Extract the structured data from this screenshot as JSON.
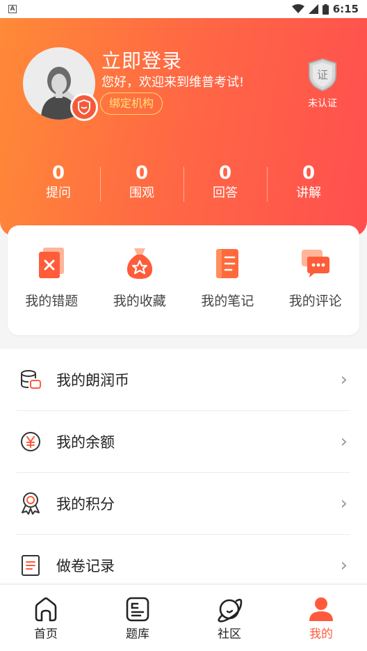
{
  "status_bar": {
    "time": "6:15",
    "left_icon": "A"
  },
  "profile": {
    "title": "立即登录",
    "welcome": "您好，欢迎来到维普考试!",
    "bind_button": "绑定机构",
    "cert_glyph": "证",
    "cert_label": "未认证"
  },
  "stats": [
    {
      "value": "0",
      "label": "提问"
    },
    {
      "value": "0",
      "label": "围观"
    },
    {
      "value": "0",
      "label": "回答"
    },
    {
      "value": "0",
      "label": "讲解"
    }
  ],
  "quick_actions": [
    {
      "label": "我的错题",
      "icon": "wrong-questions-icon"
    },
    {
      "label": "我的收藏",
      "icon": "favorites-bag-icon"
    },
    {
      "label": "我的笔记",
      "icon": "notes-icon"
    },
    {
      "label": "我的评论",
      "icon": "comments-icon"
    }
  ],
  "menu": [
    {
      "label": "我的朗润币",
      "icon": "coins-icon"
    },
    {
      "label": "我的余额",
      "icon": "yuan-icon"
    },
    {
      "label": "我的积分",
      "icon": "medal-icon"
    },
    {
      "label": "做卷记录",
      "icon": "exam-record-icon"
    }
  ],
  "tabs": [
    {
      "label": "首页",
      "icon": "home-icon",
      "active": false
    },
    {
      "label": "题库",
      "icon": "question-bank-icon",
      "active": false
    },
    {
      "label": "社区",
      "icon": "community-planet-icon",
      "active": false
    },
    {
      "label": "我的",
      "icon": "profile-icon",
      "active": true
    }
  ],
  "colors": {
    "accent": "#ff5a3d",
    "gradient_start": "#ff8a37",
    "gradient_end": "#ff4f4f",
    "bind_outline": "#ffd76a"
  }
}
